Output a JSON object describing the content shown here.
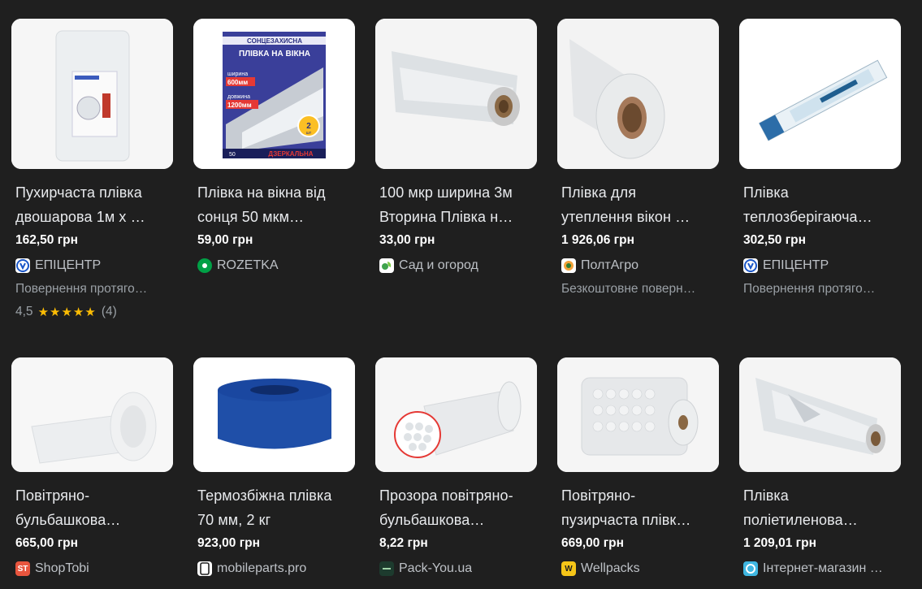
{
  "products": [
    {
      "title": "Пухирчаста плівка двошарова 1м х ...",
      "title_lines": [
        "Пухирчаста плівка",
        "двошарова 1м х …"
      ],
      "price": "162,50 грн",
      "merchant": "ЕПІЦЕНТР",
      "merchant_color": "#1a56c8",
      "extra": "Повернення протяго…",
      "rating_value": "4,5",
      "rating_stars": "★★★★★",
      "rating_count": "(4)"
    },
    {
      "title_lines": [
        "Плівка на вікна від",
        "сонця 50 мкм…"
      ],
      "price": "59,00 грн",
      "merchant": "ROZETKA",
      "merchant_color": "#00a046",
      "image_text": {
        "top": "СОНЦЕЗАХИСНА",
        "main": "ПЛІВКА НА ВІКНА",
        "w_label": "ширина",
        "w_value": "600мм",
        "l_label": "довжина",
        "l_value": "1200мм",
        "qty": "2",
        "qty_unit": "шт",
        "bottom": "ДЗЕРКАЛЬНА",
        "num": "50"
      }
    },
    {
      "title_lines": [
        "100 мкр ширина 3м",
        "Вторина Плівка н…"
      ],
      "price": "33,00 грн",
      "merchant": "Сад и огород",
      "merchant_color": "#ffffff"
    },
    {
      "title_lines": [
        "Плівка для",
        "утеплення вікон …"
      ],
      "price": "1 926,06 грн",
      "merchant": "ПолтАгро",
      "merchant_color": "#ffffff",
      "extra": "Безкоштовне поверн…"
    },
    {
      "title_lines": [
        "Плівка",
        "теплозберігаюча…"
      ],
      "price": "302,50 грн",
      "merchant": "ЕПІЦЕНТР",
      "merchant_color": "#1a56c8",
      "extra": "Повернення протяго…"
    },
    {
      "title_lines": [
        "Повітряно-",
        "бульбашкова…"
      ],
      "price": "665,00 грн",
      "merchant": "ShopTobi",
      "merchant_color": "#e8553e",
      "merchant_logo_text": "ST"
    },
    {
      "title_lines": [
        "Термозбіжна плівка",
        "70 мм, 2 кг"
      ],
      "price": "923,00 грн",
      "merchant": "mobileparts.pro",
      "merchant_color": "#ffffff"
    },
    {
      "title_lines": [
        "Прозора повітряно-",
        "бульбашкова…"
      ],
      "price": "8,22 грн",
      "merchant": "Pack-You.ua",
      "merchant_color": "#1d3b2e"
    },
    {
      "title_lines": [
        "Повітряно-",
        "пузирчаста плівк…"
      ],
      "price": "669,00 грн",
      "merchant": "Wellpacks",
      "merchant_color": "#f5c518",
      "merchant_logo_text": "W"
    },
    {
      "title_lines": [
        "Плівка",
        "поліетиленова…"
      ],
      "price": "1 209,01 грн",
      "merchant": "Інтернет-магазин …",
      "merchant_color": "#3fb6e0"
    }
  ]
}
